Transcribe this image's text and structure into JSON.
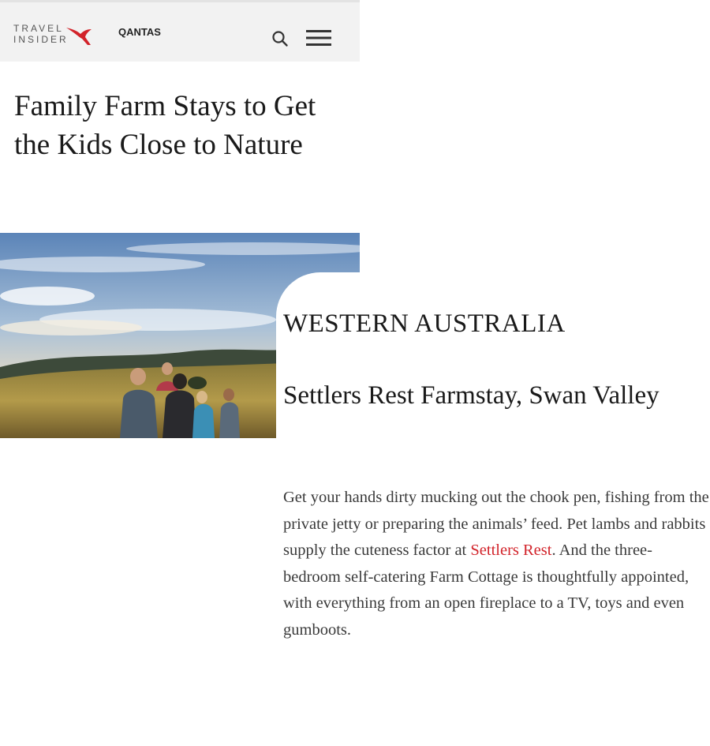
{
  "header": {
    "logo_line1": "TRAVEL",
    "logo_line2": "INSIDER",
    "brand": "QANTAS",
    "brand_color": "#d2232a",
    "icons": [
      "kangaroo-logo-icon",
      "search-icon",
      "hamburger-menu-icon"
    ]
  },
  "article": {
    "title": "Family Farm Stays to Get the Kids Close to Nature"
  },
  "section": {
    "region": "WESTERN AUSTRALIA",
    "stay_title": "Settlers Rest Farmstay, Swan Valley",
    "body_before_link": "Get your hands dirty mucking out the chook pen, fishing from the private jetty or preparing the animals’ feed. Pet lambs and rabbits supply the cuteness factor at ",
    "link_text": "Settlers Rest",
    "body_after_link": ". And the three-bedroom self-catering Farm Cottage is thoughtfully appointed, with everything from an open fireplace to a TV, toys and even gumboots.",
    "link_color": "#d2232a"
  }
}
